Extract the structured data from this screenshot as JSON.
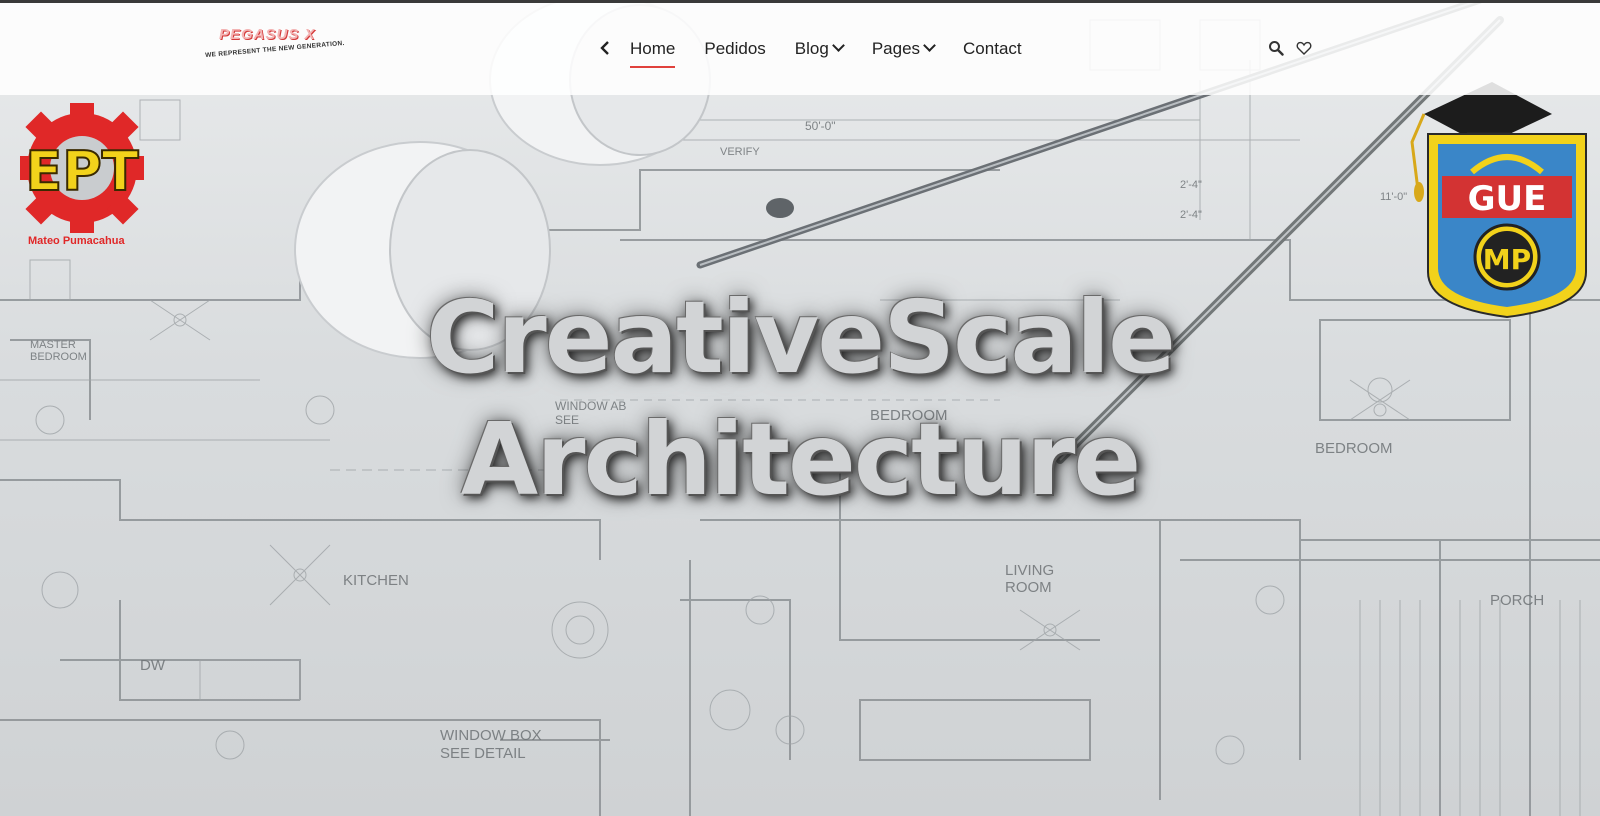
{
  "brand": {
    "name": "PEGASUS X",
    "tagline": "WE REPRESENT THE NEW GENERATION."
  },
  "nav": {
    "items": [
      {
        "label": "Home",
        "active": true,
        "dropdown": false
      },
      {
        "label": "Pedidos",
        "active": false,
        "dropdown": false
      },
      {
        "label": "Blog",
        "active": false,
        "dropdown": true
      },
      {
        "label": "Pages",
        "active": false,
        "dropdown": true
      },
      {
        "label": "Contact",
        "active": false,
        "dropdown": false
      }
    ]
  },
  "tools": {
    "search_icon": "search-icon",
    "wishlist_icon": "heart-icon"
  },
  "hero": {
    "title_line1": "CreativeScale",
    "title_line2": "Architecture"
  },
  "logos": {
    "left": {
      "letters": "EPT",
      "caption": "Mateo Pumacahua"
    },
    "right": {
      "letters": "GUE",
      "emblem": "MP"
    }
  },
  "colors": {
    "accent": "#e0413c",
    "ept_red": "#e02828",
    "ept_yellow": "#f2d21b",
    "gue_blue": "#3a86c8"
  }
}
